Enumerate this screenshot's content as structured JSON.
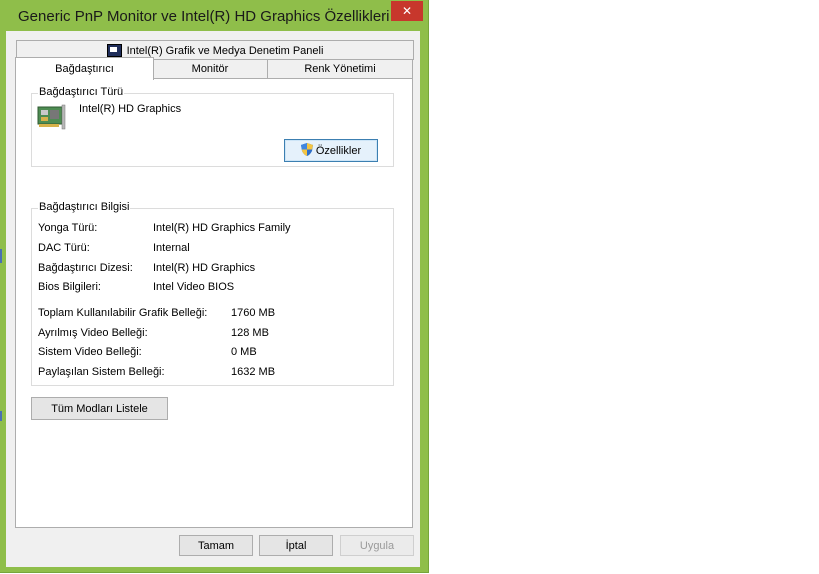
{
  "window": {
    "title": "Generic PnP Monitor ve Intel(R) HD Graphics Özellikleri",
    "close_glyph": "✕",
    "accent": "#8fbe4a"
  },
  "tabs": {
    "top_row": "Intel(R) Grafik ve Medya Denetim Paneli",
    "bottom_row": [
      "Bağdaştırıcı",
      "Monitör",
      "Renk Yönetimi"
    ]
  },
  "adapter_type": {
    "group_label": "Bağdaştırıcı Türü",
    "name": "Intel(R) HD Graphics",
    "properties_button": "Özellikler"
  },
  "adapter_info": {
    "group_label": "Bağdaştırıcı Bilgisi",
    "rows": [
      {
        "label": "Yonga Türü:",
        "value": "Intel(R) HD Graphics Family"
      },
      {
        "label": "DAC Türü:",
        "value": "Internal"
      },
      {
        "label": "Bağdaştırıcı Dizesi:",
        "value": "Intel(R) HD Graphics"
      },
      {
        "label": "Bios Bilgileri:",
        "value": "Intel Video BIOS"
      }
    ],
    "memory": [
      {
        "label": "Toplam Kullanılabilir Grafik Belleği:",
        "value": "1760 MB"
      },
      {
        "label": "Ayrılmış Video Belleği:",
        "value": "128 MB"
      },
      {
        "label": "Sistem Video Belleği:",
        "value": "0 MB"
      },
      {
        "label": "Paylaşılan Sistem Belleği:",
        "value": "1632 MB"
      }
    ]
  },
  "list_modes_button": "Tüm Modları Listele",
  "footer": {
    "ok": "Tamam",
    "cancel": "İptal",
    "apply": "Uygula"
  }
}
